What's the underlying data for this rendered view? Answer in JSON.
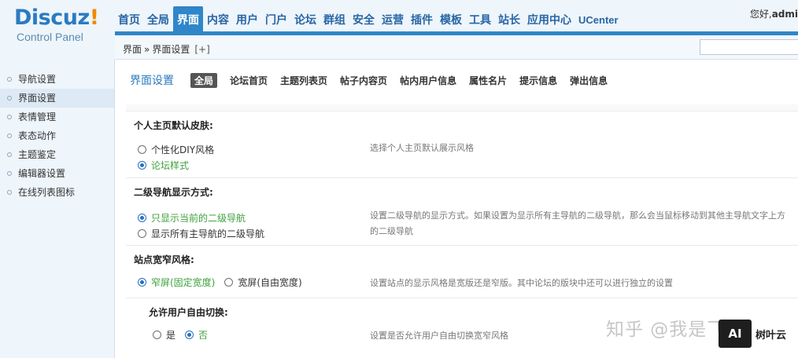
{
  "logo": {
    "brand_main": "Discuz",
    "brand_exclaim": "!",
    "subtitle": "Control Panel"
  },
  "nav": {
    "items": [
      "首页",
      "全局",
      "界面",
      "内容",
      "用户",
      "门户",
      "论坛",
      "群组",
      "安全",
      "运营",
      "插件",
      "模板",
      "工具",
      "站长",
      "应用中心",
      "UCenter"
    ],
    "active_index": 2
  },
  "greeting": {
    "prefix": "您好,",
    "user": "admi"
  },
  "breadcrumb": {
    "parent": "界面",
    "separator": "»",
    "current": "界面设置",
    "add": "[+]"
  },
  "sidebar": {
    "items": [
      "导航设置",
      "界面设置",
      "表情管理",
      "表态动作",
      "主题鉴定",
      "编辑器设置",
      "在线列表图标"
    ],
    "active_index": 1
  },
  "page": {
    "title": "界面设置",
    "tabs": [
      "全局",
      "论坛首页",
      "主题列表页",
      "帖子内容页",
      "帖内用户信息",
      "属性名片",
      "提示信息",
      "弹出信息"
    ],
    "active_tab": 0
  },
  "settings": {
    "skin": {
      "label": "个人主页默认皮肤:",
      "options": [
        "个性化DIY风格",
        "论坛样式"
      ],
      "selected": 1,
      "description": "选择个人主页默认展示风格"
    },
    "subnav": {
      "label": "二级导航显示方式:",
      "options": [
        "只显示当前的二级导航",
        "显示所有主导航的二级导航"
      ],
      "selected": 0,
      "description_line1": "设置二级导航的显示方式。如果设置为显示所有主导航的二级导航，那么会当鼠标移动到其他主导航文字上方",
      "description_line2": "的二级导航"
    },
    "width": {
      "label": "站点宽窄风格:",
      "options": [
        "窄屏(固定宽度)",
        "宽屏(自由宽度)"
      ],
      "selected": 0,
      "description": "设置站点的显示风格是宽版还是窄版。其中论坛的版块中还可以进行独立的设置"
    },
    "switch": {
      "label": "允许用户自由切换:",
      "options": [
        "是",
        "否"
      ],
      "selected": 1,
      "description": "设置是否允许用户自由切换宽窄风格"
    }
  },
  "watermark": {
    "text": "知乎 @我是飞飞",
    "badge": "AI",
    "badge_name": "树叶云"
  },
  "colors": {
    "brand_blue": "#2f86c8",
    "accent_orange": "#f08a00",
    "selected_green": "#3ea13e"
  }
}
